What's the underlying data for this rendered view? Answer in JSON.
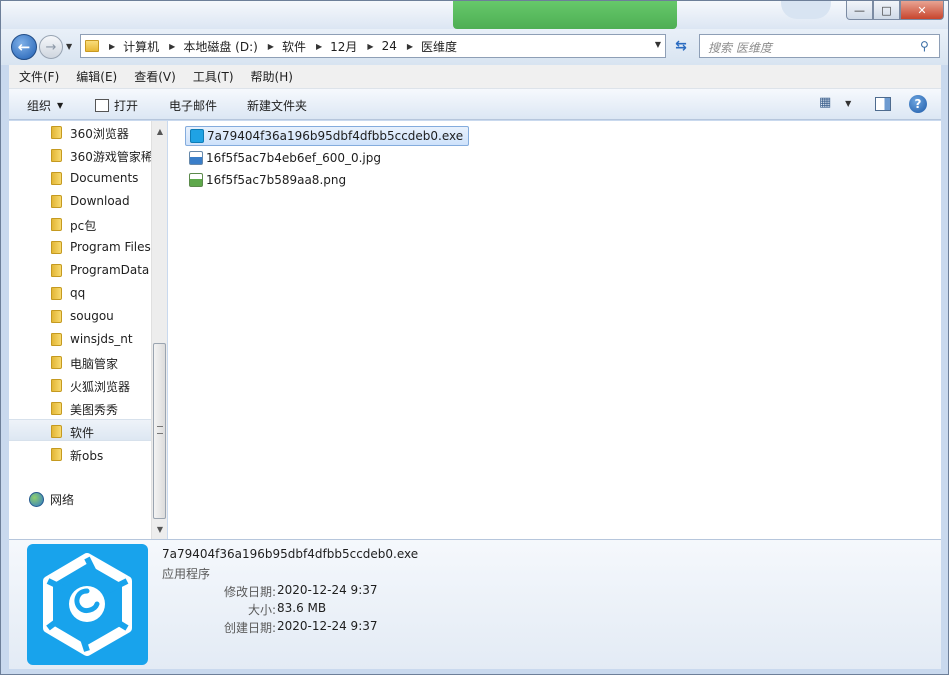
{
  "window": {
    "controls": {
      "minimize": "—",
      "maximize": "□",
      "close": "✕"
    }
  },
  "navigation": {
    "back_glyph": "←",
    "forward_glyph": "→",
    "breadcrumbs": [
      "计算机",
      "本地磁盘 (D:)",
      "软件",
      "12月",
      "24",
      "医维度"
    ],
    "search_placeholder": "搜索 医维度"
  },
  "menubar": {
    "items": [
      "文件(F)",
      "编辑(E)",
      "查看(V)",
      "工具(T)",
      "帮助(H)"
    ]
  },
  "toolbar": {
    "organize": "组织",
    "open": "打开",
    "email": "电子邮件",
    "new_folder": "新建文件夹"
  },
  "navpane": {
    "folders": [
      "360浏览器",
      "360游戏管家稀",
      "Documents",
      "Download",
      "pc包",
      "Program Files",
      "ProgramData",
      "qq",
      "sougou",
      "winsjds_nt",
      "电脑管家",
      "火狐浏览器",
      "美图秀秀",
      "软件",
      "新obs"
    ],
    "selected": "软件",
    "network": "网络"
  },
  "files": [
    {
      "name": "7a79404f36a196b95dbf4dfbb5ccdeb0.exe",
      "type": "exe",
      "selected": true
    },
    {
      "name": "16f5f5ac7b4eb6ef_600_0.jpg",
      "type": "jpg",
      "selected": false
    },
    {
      "name": "16f5f5ac7b589aa8.png",
      "type": "png",
      "selected": false
    }
  ],
  "details": {
    "name": "7a79404f36a196b95dbf4dfbb5ccdeb0.exe",
    "type": "应用程序",
    "modified_label": "修改日期:",
    "modified_value": "2020-12-24 9:37",
    "size_label": "大小:",
    "size_value": "83.6 MB",
    "created_label": "创建日期:",
    "created_value": "2020-12-24 9:37",
    "icon_color": "#18a3ec"
  }
}
